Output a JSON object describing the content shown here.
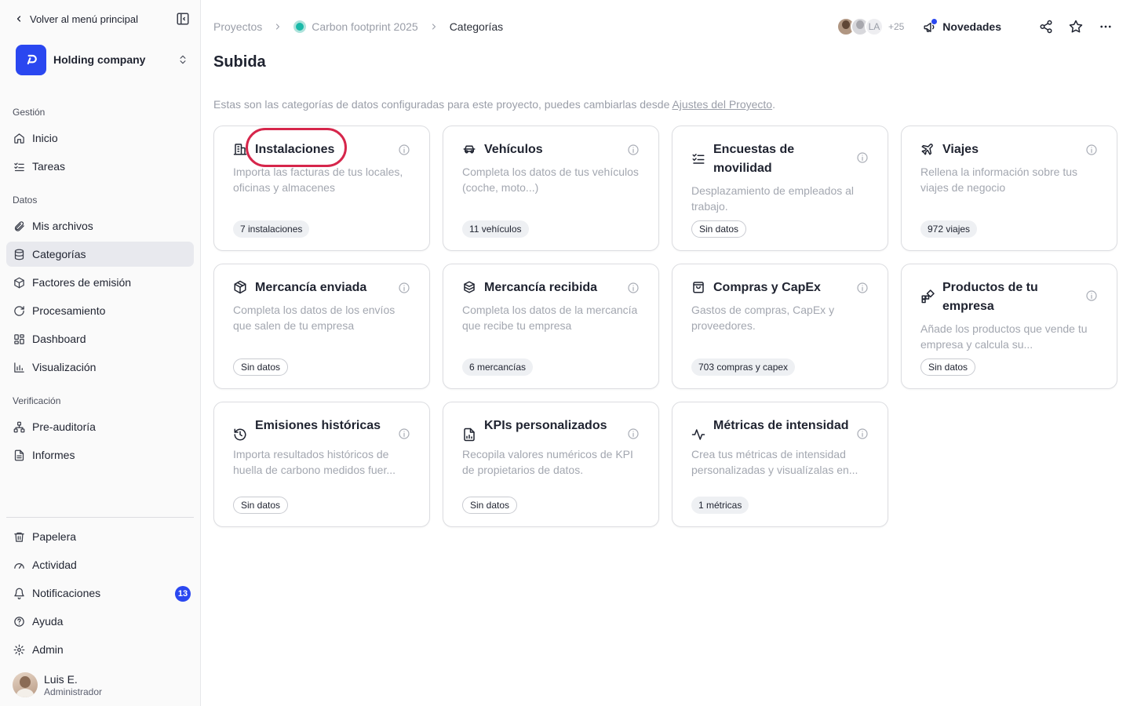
{
  "sidebar": {
    "back_label": "Volver al menú principal",
    "org_name": "Holding company",
    "sections": {
      "gestion": "Gestión",
      "datos": "Datos",
      "verificacion": "Verificación"
    },
    "items": {
      "inicio": "Inicio",
      "tareas": "Tareas",
      "mis_archivos": "Mis archivos",
      "categorias": "Categorías",
      "factores": "Factores de emisión",
      "procesamiento": "Procesamiento",
      "dashboard": "Dashboard",
      "visualizacion": "Visualización",
      "preauditoria": "Pre-auditoría",
      "informes": "Informes",
      "papelera": "Papelera",
      "actividad": "Actividad",
      "notificaciones": "Notificaciones",
      "ayuda": "Ayuda",
      "admin": "Admin"
    },
    "notifications_count": "13",
    "user": {
      "name": "Luis E.",
      "role": "Administrador"
    }
  },
  "header": {
    "breadcrumb": [
      "Proyectos",
      "Carbon footprint 2025",
      "Categorías"
    ],
    "avatars_initials": "LA",
    "avatars_more": "+25",
    "news_label": "Novedades"
  },
  "page": {
    "title": "Subida",
    "intro_text": "Estas son las categorías de datos configuradas para este proyecto, puedes cambiarlas desde ",
    "intro_link": "Ajustes del Proyecto",
    "intro_end": "."
  },
  "cards": [
    {
      "title": "Instalaciones",
      "desc": "Importa las facturas de tus locales, oficinas y almacenes",
      "badge": "7 instalaciones",
      "icon": "building-icon"
    },
    {
      "title": "Vehículos",
      "desc": "Completa los datos de tus vehículos (coche, moto...)",
      "badge": "11 vehículos",
      "icon": "car-icon"
    },
    {
      "title": "Encuestas de movilidad",
      "desc": "Desplazamiento de empleados al trabajo.",
      "badge": "Sin datos",
      "icon": "checklist-icon"
    },
    {
      "title": "Viajes",
      "desc": "Rellena la información sobre tus viajes de negocio",
      "badge": "972 viajes",
      "icon": "plane-icon"
    },
    {
      "title": "Mercancía enviada",
      "desc": "Completa los datos de los envíos que salen de tu empresa",
      "badge": "Sin datos",
      "icon": "package-icon"
    },
    {
      "title": "Mercancía recibida",
      "desc": "Completa los datos de la mercancía que recibe tu empresa",
      "badge": "6 mercancías",
      "icon": "boxes-icon"
    },
    {
      "title": "Compras y CapEx",
      "desc": "Gastos de compras, CapEx y proveedores.",
      "badge": "703 compras y capex",
      "icon": "shopping-bag-icon"
    },
    {
      "title": "Productos de tu empresa",
      "desc": "Añade los productos que vende tu empresa y calcula su...",
      "badge": "Sin datos",
      "icon": "products-icon"
    },
    {
      "title": "Emisiones históricas",
      "desc": "Importa resultados históricos de huella de carbono medidos fuer...",
      "badge": "Sin datos",
      "icon": "history-icon"
    },
    {
      "title": "KPIs personalizados",
      "desc": "Recopila valores numéricos de KPI de propietarios de datos.",
      "badge": "Sin datos",
      "icon": "file-chart-icon"
    },
    {
      "title": "Métricas de intensidad",
      "desc": "Crea tus métricas de intensidad personalizadas y visualízalas en...",
      "badge": "1 métricas",
      "icon": "activity-icon"
    }
  ],
  "colors": {
    "accent": "#2a47f0",
    "highlight": "#d6264b",
    "project_dot": "#1ab9a8"
  }
}
